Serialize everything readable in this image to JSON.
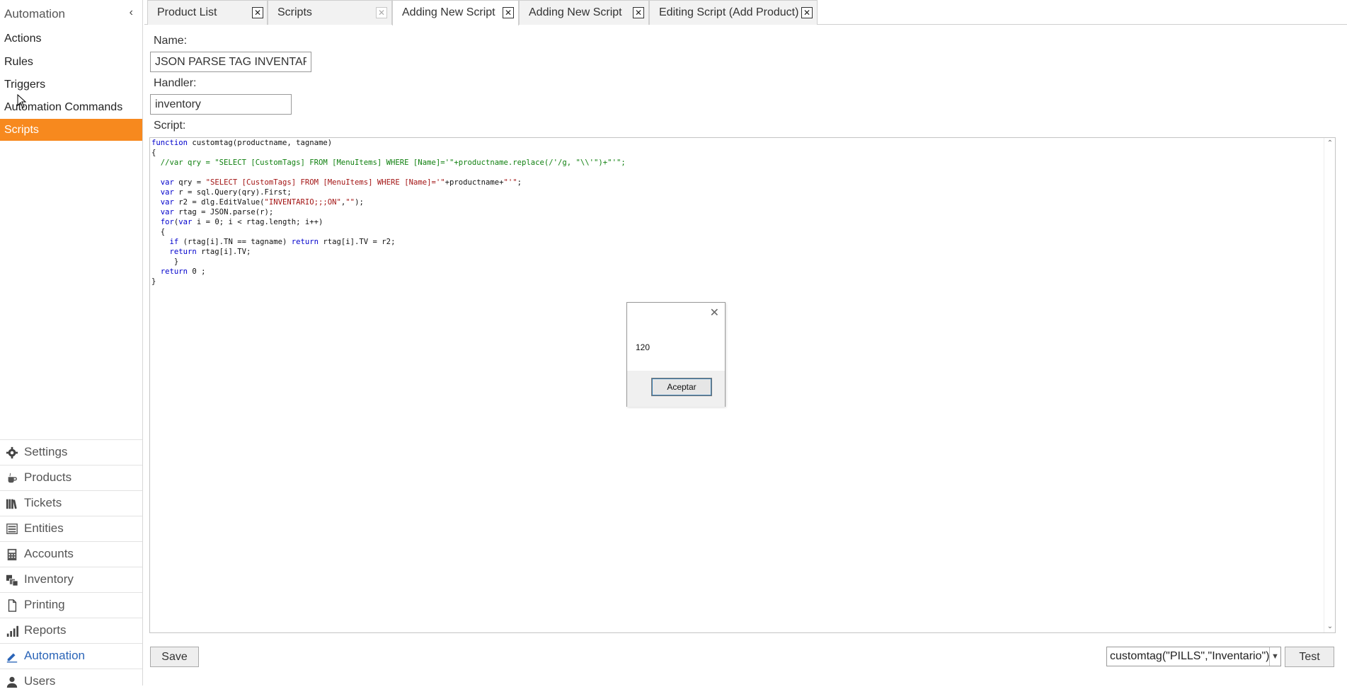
{
  "sidebar": {
    "title": "Automation",
    "collapse_icon": "chevron-left-icon",
    "items": [
      {
        "label": "Actions"
      },
      {
        "label": "Rules"
      },
      {
        "label": "Triggers"
      },
      {
        "label": "Automation Commands"
      },
      {
        "label": "Scripts",
        "active": true
      }
    ],
    "nav": [
      {
        "label": "Settings",
        "icon": "gear-icon"
      },
      {
        "label": "Products",
        "icon": "coffee-cup-icon"
      },
      {
        "label": "Tickets",
        "icon": "books-icon"
      },
      {
        "label": "Entities",
        "icon": "list-icon"
      },
      {
        "label": "Accounts",
        "icon": "calculator-icon"
      },
      {
        "label": "Inventory",
        "icon": "boxes-icon"
      },
      {
        "label": "Printing",
        "icon": "document-icon"
      },
      {
        "label": "Reports",
        "icon": "bar-chart-icon"
      },
      {
        "label": "Automation",
        "icon": "pencil-icon",
        "active": true
      },
      {
        "label": "Users",
        "icon": "user-icon"
      }
    ],
    "accent_color": "#f7891e"
  },
  "tabs": [
    {
      "label": "Product List"
    },
    {
      "label": "Scripts"
    },
    {
      "label": "Adding New Script",
      "active": true
    },
    {
      "label": "Adding New Script"
    },
    {
      "label": "Editing Script (Add Product)"
    }
  ],
  "form": {
    "name_label": "Name:",
    "name_value": "JSON PARSE TAG INVENTARIO",
    "handler_label": "Handler:",
    "handler_value": "inventory",
    "script_label": "Script:"
  },
  "dialog": {
    "message": "120",
    "button_label": "Aceptar"
  },
  "footer": {
    "save_label": "Save",
    "test_expression": "customtag(\"PILLS\",\"Inventario\")",
    "test_label": "Test"
  }
}
